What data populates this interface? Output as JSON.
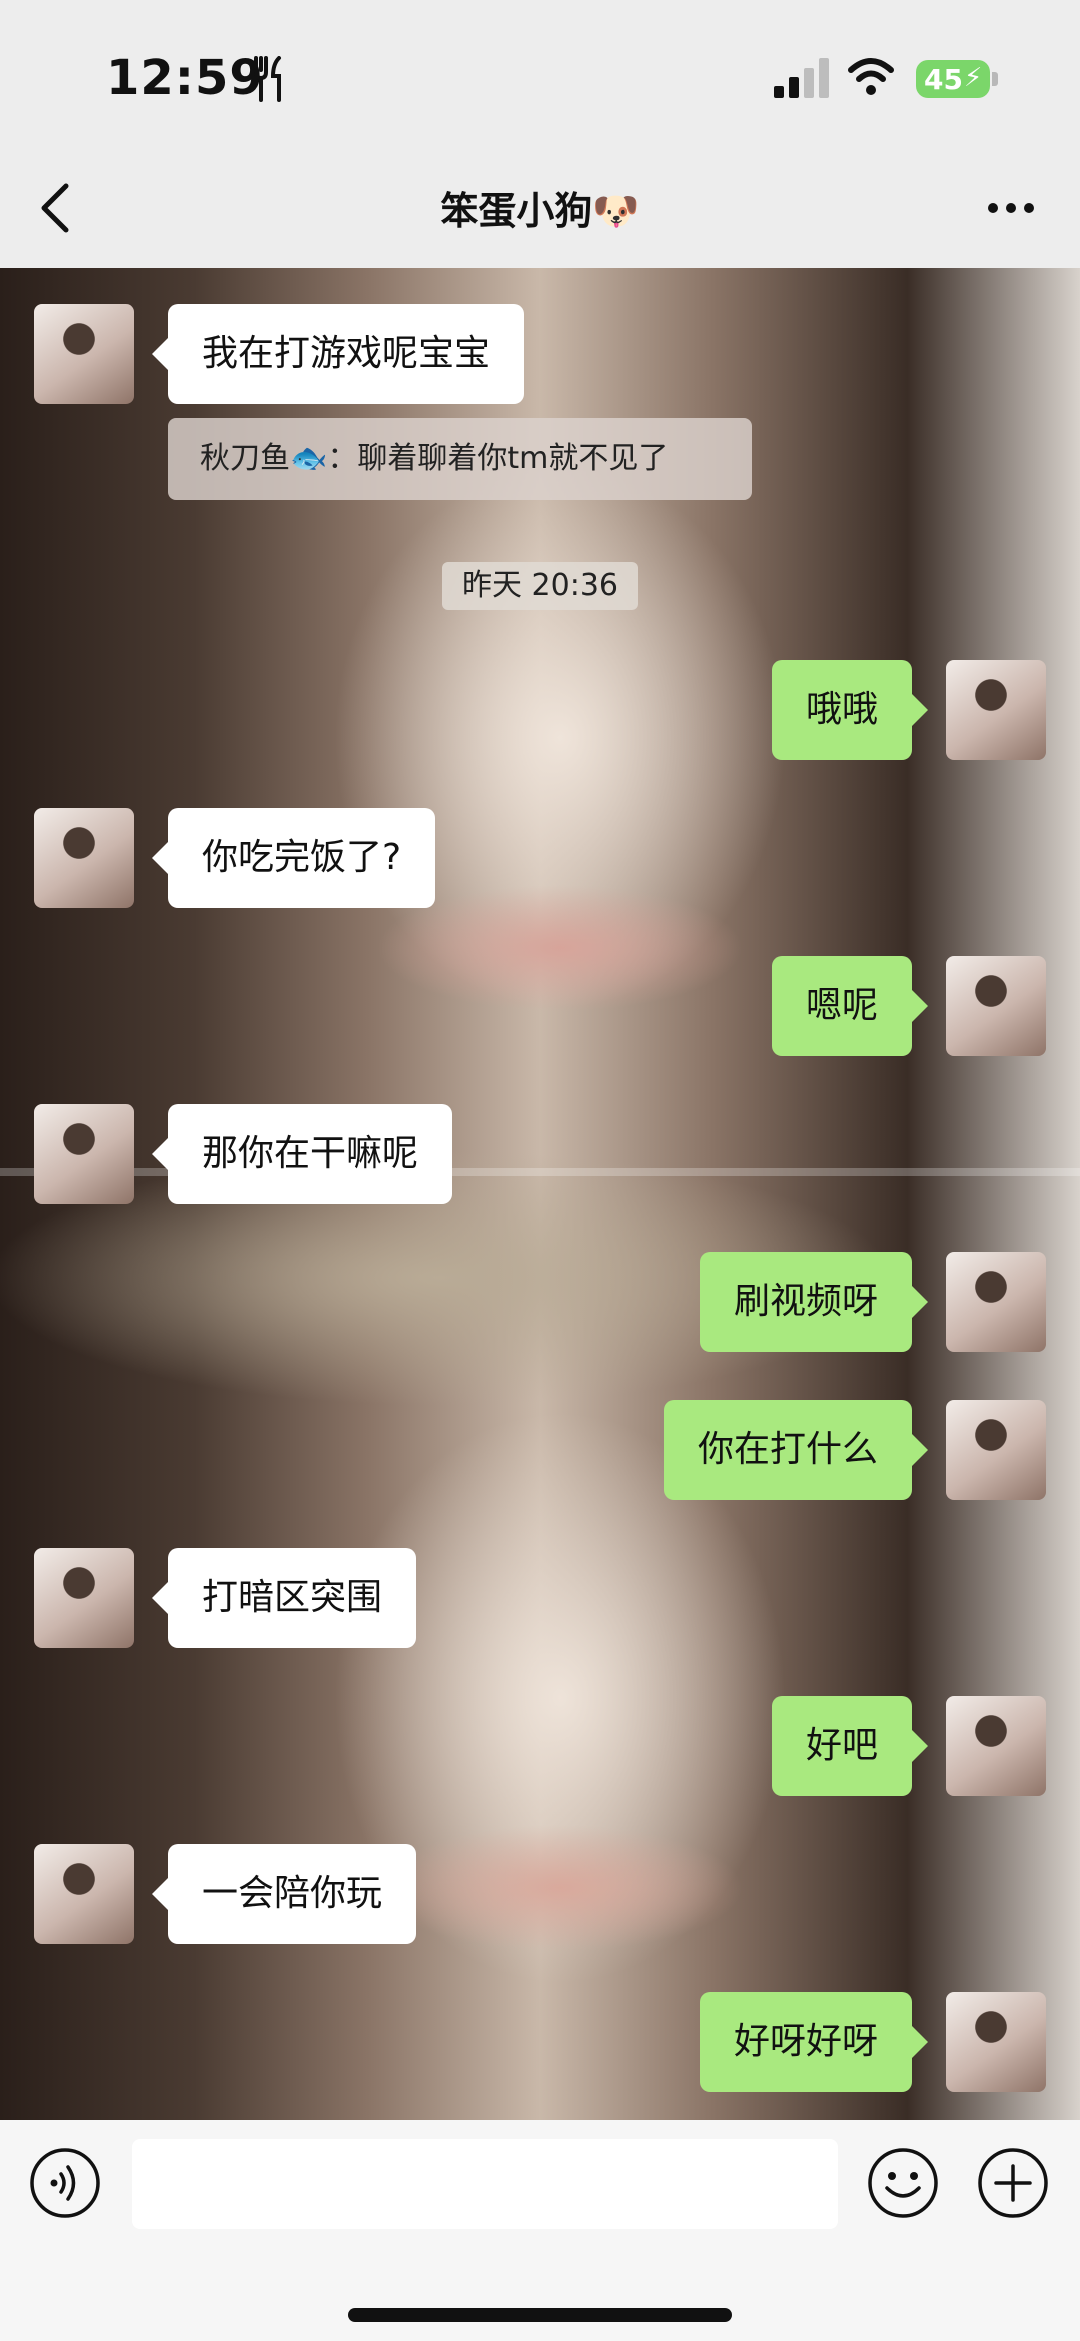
{
  "status_bar": {
    "time": "12:59",
    "battery": "45"
  },
  "nav": {
    "title": "笨蛋小狗🐶"
  },
  "messages": [
    {
      "side": "in",
      "text": "我在打游戏呢宝宝"
    },
    {
      "type": "quote",
      "text": "秋刀鱼🐟：聊着聊着你tm就不见了"
    },
    {
      "type": "time",
      "text": "昨天 20:36"
    },
    {
      "side": "out",
      "text": "哦哦"
    },
    {
      "side": "in",
      "text": "你吃完饭了?"
    },
    {
      "side": "out",
      "text": "嗯呢"
    },
    {
      "side": "in",
      "text": "那你在干嘛呢"
    },
    {
      "side": "out",
      "text": "刷视频呀"
    },
    {
      "side": "out",
      "text": "你在打什么"
    },
    {
      "side": "in",
      "text": "打暗区突围"
    },
    {
      "side": "out",
      "text": "好吧"
    },
    {
      "side": "in",
      "text": "一会陪你玩"
    },
    {
      "side": "out",
      "text": "好呀好呀"
    }
  ],
  "icons": {
    "back": "chevron-left-icon",
    "more": "more-dots-icon",
    "voice": "voice-icon",
    "emoji": "smiley-icon",
    "plus": "plus-circle-icon"
  },
  "colors": {
    "outgoing_bubble": "#a9e97f",
    "incoming_bubble": "#ffffff",
    "battery": "#7bd66a"
  }
}
